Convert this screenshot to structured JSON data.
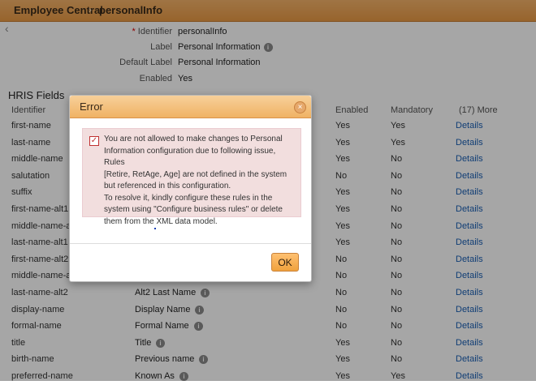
{
  "header": {
    "crumb1": "Employee Central",
    "crumb2": "personalInfo"
  },
  "properties": [
    {
      "label": "Identifier",
      "required": true,
      "value": "personalInfo"
    },
    {
      "label": "Label",
      "value": "Personal Information",
      "has_info": true
    },
    {
      "label": "Default Label",
      "value": "Personal Information"
    },
    {
      "label": "Enabled",
      "value": "Yes"
    }
  ],
  "hris": {
    "title": "HRIS Fields",
    "columns": {
      "identifier": "Identifier",
      "enabled": "Enabled",
      "mandatory": "Mandatory",
      "more": "(17) More"
    },
    "rows": [
      {
        "id": "first-name",
        "label": "",
        "enabled": "Yes",
        "mandatory": "Yes",
        "details": "Details"
      },
      {
        "id": "last-name",
        "label": "",
        "enabled": "Yes",
        "mandatory": "Yes",
        "details": "Details"
      },
      {
        "id": "middle-name",
        "label": "",
        "enabled": "Yes",
        "mandatory": "No",
        "details": "Details"
      },
      {
        "id": "salutation",
        "label": "",
        "enabled": "No",
        "mandatory": "No",
        "details": "Details"
      },
      {
        "id": "suffix",
        "label": "",
        "enabled": "Yes",
        "mandatory": "No",
        "details": "Details"
      },
      {
        "id": "first-name-alt1",
        "label": "",
        "enabled": "Yes",
        "mandatory": "No",
        "details": "Details"
      },
      {
        "id": "middle-name-alt1",
        "label": "",
        "enabled": "Yes",
        "mandatory": "No",
        "details": "Details"
      },
      {
        "id": "last-name-alt1",
        "label": "",
        "enabled": "Yes",
        "mandatory": "No",
        "details": "Details"
      },
      {
        "id": "first-name-alt2",
        "label": "",
        "enabled": "No",
        "mandatory": "No",
        "details": "Details"
      },
      {
        "id": "middle-name-alt2",
        "label": "",
        "enabled": "No",
        "mandatory": "No",
        "details": "Details"
      },
      {
        "id": "last-name-alt2",
        "label": "Alt2 Last Name",
        "enabled": "No",
        "mandatory": "No",
        "details": "Details"
      },
      {
        "id": "display-name",
        "label": "Display Name",
        "enabled": "No",
        "mandatory": "No",
        "details": "Details"
      },
      {
        "id": "formal-name",
        "label": "Formal Name",
        "enabled": "No",
        "mandatory": "No",
        "details": "Details"
      },
      {
        "id": "title",
        "label": "Title",
        "enabled": "Yes",
        "mandatory": "No",
        "details": "Details"
      },
      {
        "id": "birth-name",
        "label": "Previous name",
        "enabled": "Yes",
        "mandatory": "No",
        "details": "Details"
      },
      {
        "id": "preferred-name",
        "label": "Known As",
        "enabled": "Yes",
        "mandatory": "Yes",
        "details": "Details"
      }
    ]
  },
  "dialog": {
    "title": "Error",
    "close": "×",
    "message_lines": [
      "You are not allowed to make changes to Personal",
      "Information configuration due to following issue, Rules",
      "[Retire, RetAge, Age] are not defined in the system",
      "but referenced in this configuration.",
      "To resolve it, kindly configure these rules in the",
      "system using \"Configure business rules\" or delete",
      "them from the XML data model."
    ],
    "ok_label": "OK"
  },
  "colors": {
    "header": "#e99a45",
    "link": "#1a5fb4",
    "error_bg": "#f2dede",
    "ok_button": "#f0a23d"
  },
  "icons": {
    "back": "chevron-left-icon",
    "info": "info-icon",
    "close": "close-icon",
    "check": "checkbox-icon"
  }
}
